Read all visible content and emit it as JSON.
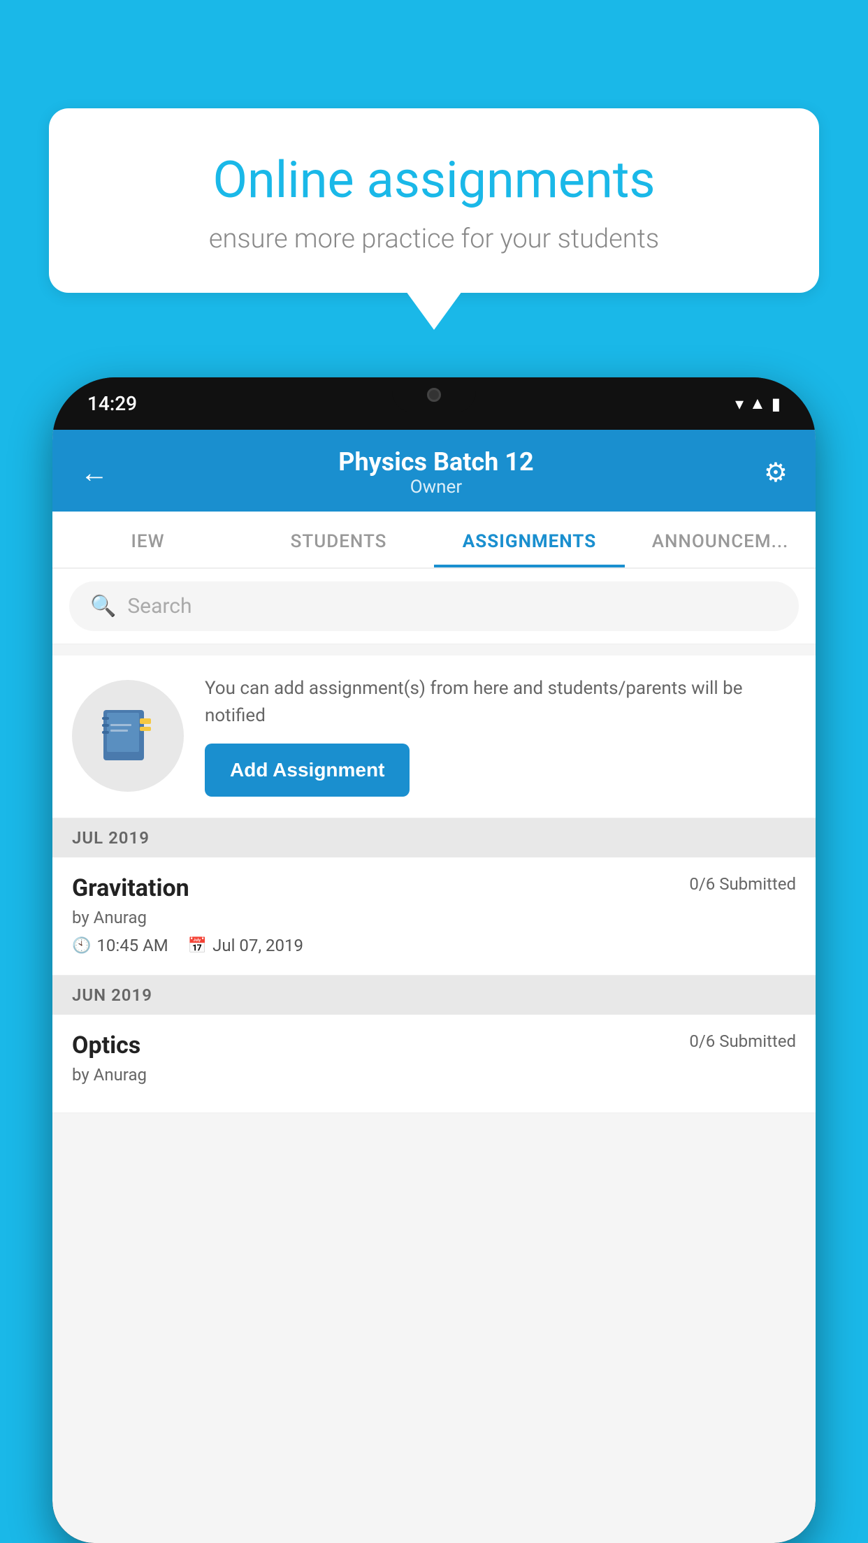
{
  "background_color": "#1ab8e8",
  "speech_bubble": {
    "title": "Online assignments",
    "subtitle": "ensure more practice for your students"
  },
  "phone": {
    "status_bar": {
      "time": "14:29"
    },
    "header": {
      "title": "Physics Batch 12",
      "subtitle": "Owner",
      "back_label": "←",
      "settings_label": "⚙"
    },
    "tabs": [
      {
        "label": "IEW",
        "active": false
      },
      {
        "label": "STUDENTS",
        "active": false
      },
      {
        "label": "ASSIGNMENTS",
        "active": true
      },
      {
        "label": "ANNOUNCEMENTS",
        "active": false
      }
    ],
    "search": {
      "placeholder": "Search"
    },
    "promo": {
      "text": "You can add assignment(s) from here and students/parents will be notified",
      "button_label": "Add Assignment"
    },
    "assignments": [
      {
        "month": "JUL 2019",
        "items": [
          {
            "name": "Gravitation",
            "status": "0/6 Submitted",
            "by": "by Anurag",
            "time": "10:45 AM",
            "date": "Jul 07, 2019"
          }
        ]
      },
      {
        "month": "JUN 2019",
        "items": [
          {
            "name": "Optics",
            "status": "0/6 Submitted",
            "by": "by Anurag",
            "time": "",
            "date": ""
          }
        ]
      }
    ]
  }
}
